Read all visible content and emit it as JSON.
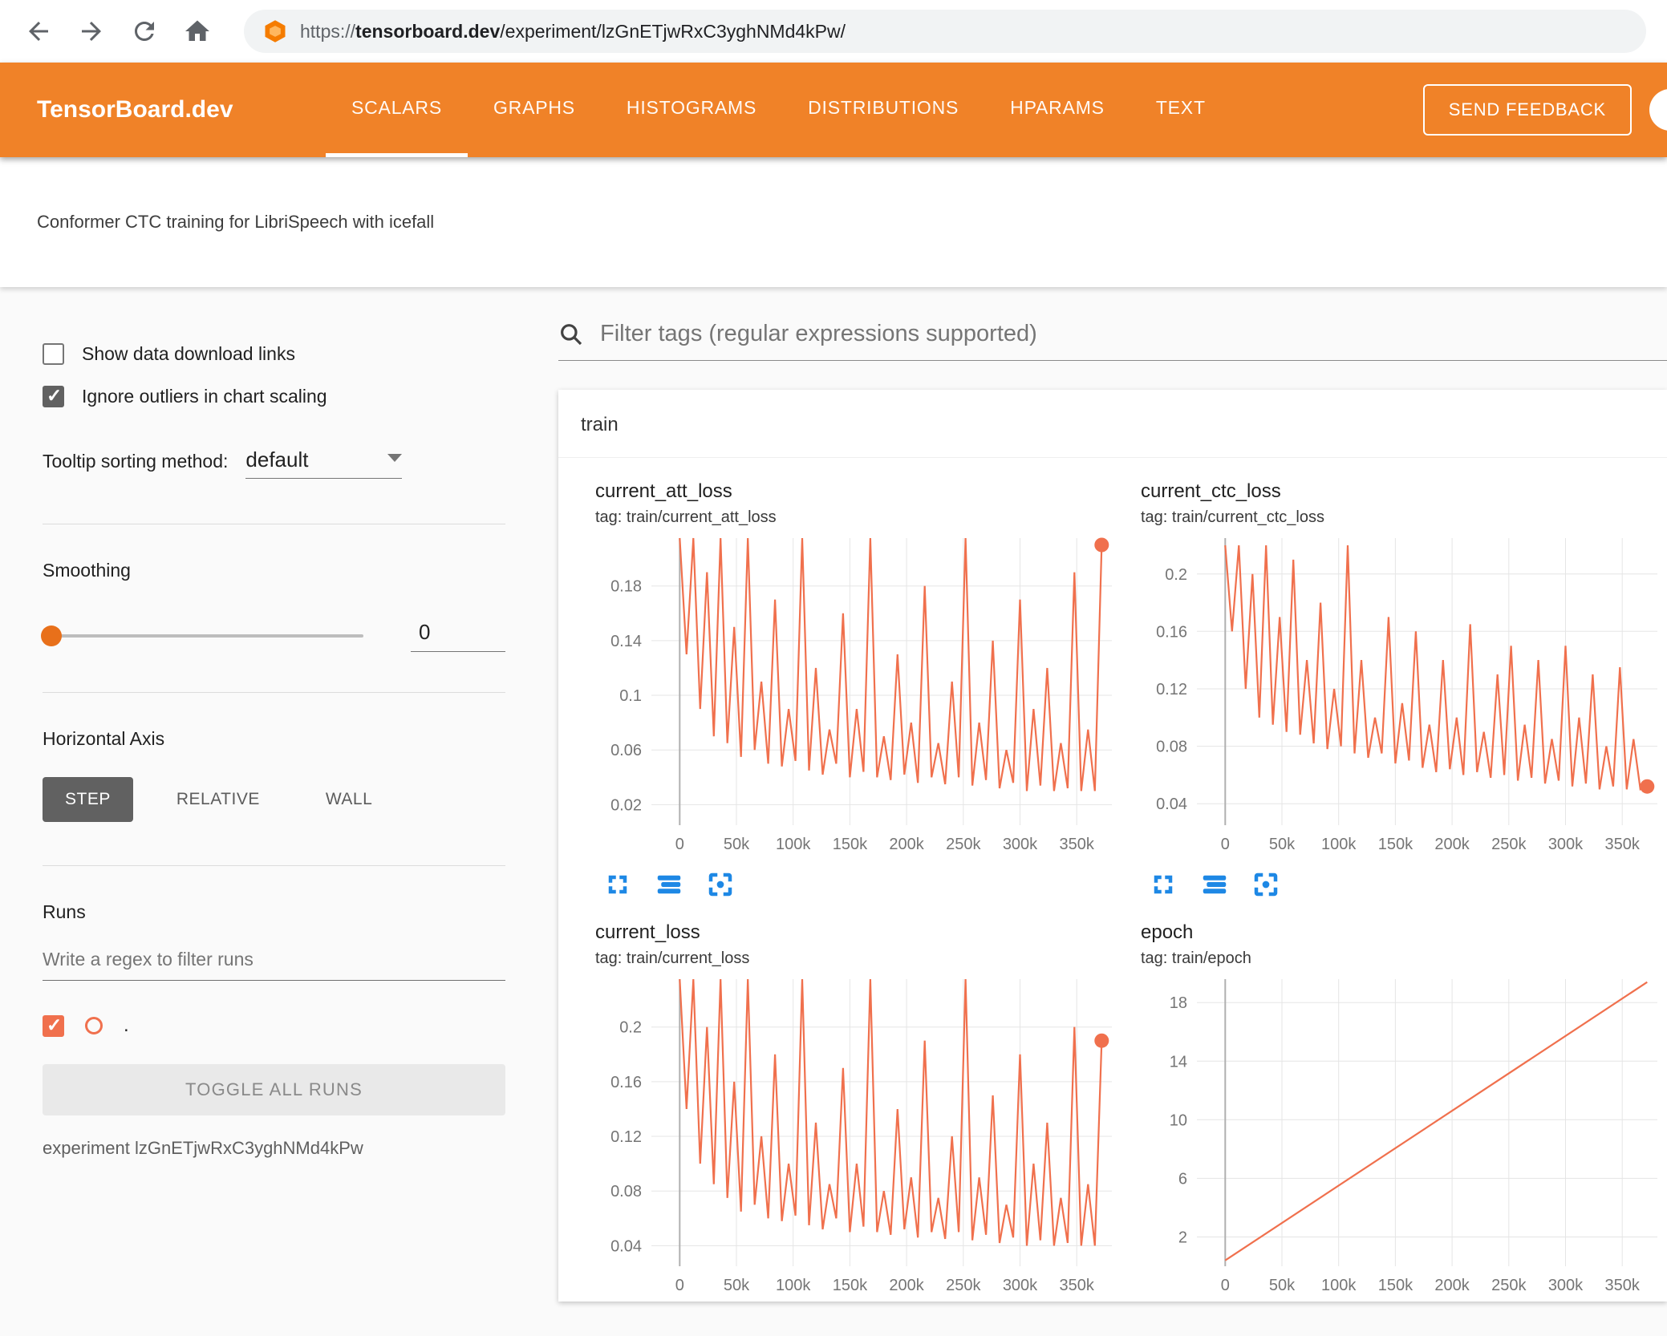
{
  "browser": {
    "url_scheme": "https://",
    "url_domain": "tensorboard.dev",
    "url_path": "/experiment/lzGnETjwRxC3yghNMd4kPw/"
  },
  "header": {
    "logo": "TensorBoard.dev",
    "tabs": [
      {
        "label": "SCALARS",
        "active": true
      },
      {
        "label": "GRAPHS",
        "active": false
      },
      {
        "label": "HISTOGRAMS",
        "active": false
      },
      {
        "label": "DISTRIBUTIONS",
        "active": false
      },
      {
        "label": "HPARAMS",
        "active": false
      },
      {
        "label": "TEXT",
        "active": false
      }
    ],
    "feedback_button": "SEND FEEDBACK"
  },
  "experiment_title": "Conformer CTC training for LibriSpeech with icefall",
  "sidebar": {
    "show_download": {
      "label": "Show data download links",
      "checked": false
    },
    "ignore_outliers": {
      "label": "Ignore outliers in chart scaling",
      "checked": true
    },
    "tooltip_sorting": {
      "label": "Tooltip sorting method:",
      "value": "default"
    },
    "smoothing": {
      "label": "Smoothing",
      "value": "0"
    },
    "horizontal_axis": {
      "label": "Horizontal Axis",
      "options": [
        "STEP",
        "RELATIVE",
        "WALL"
      ],
      "selected": "STEP"
    },
    "runs": {
      "label": "Runs",
      "filter_placeholder": "Write a regex to filter runs",
      "run_name": ".",
      "run_checked": true,
      "toggle_button": "TOGGLE ALL RUNS",
      "experiment_label": "experiment lzGnETjwRxC3yghNMd4kPw"
    }
  },
  "main": {
    "filter_placeholder": "Filter tags (regular expressions supported)",
    "section_title": "train"
  },
  "icons": {
    "back": "arrow-left",
    "forward": "arrow-right",
    "reload": "refresh",
    "home": "house",
    "search": "magnifier",
    "dropdown": "caret-down",
    "fullscreen": "expand-corners",
    "run-selector": "list-bars",
    "fit-data": "crop-frame"
  },
  "colors": {
    "header_orange": "#f08228",
    "accent_orange": "#e8701a",
    "run_color": "#f0704d",
    "icon_blue": "#1e88e5",
    "selected_button_bg": "#616161"
  },
  "chart_data": [
    {
      "type": "line",
      "title": "current_att_loss",
      "tag": "tag: train/current_att_loss",
      "color": "#f0704d",
      "end_dot": true,
      "xlim": [
        -25000,
        381000
      ],
      "ylim": [
        0.005,
        0.215
      ],
      "yticks": [
        {
          "v": 0.02,
          "l": "0.02"
        },
        {
          "v": 0.06,
          "l": "0.06"
        },
        {
          "v": 0.1,
          "l": "0.1"
        },
        {
          "v": 0.14,
          "l": "0.14"
        },
        {
          "v": 0.18,
          "l": "0.18"
        }
      ],
      "xticks": [
        {
          "v": 0,
          "l": "0"
        },
        {
          "v": 50000,
          "l": "50k"
        },
        {
          "v": 100000,
          "l": "100k"
        },
        {
          "v": 150000,
          "l": "150k"
        },
        {
          "v": 200000,
          "l": "200k"
        },
        {
          "v": 250000,
          "l": "250k"
        },
        {
          "v": 300000,
          "l": "300k"
        },
        {
          "v": 350000,
          "l": "350k"
        }
      ],
      "x": [
        0,
        6000,
        12000,
        18000,
        24000,
        30000,
        36000,
        42000,
        48000,
        54000,
        60000,
        66000,
        72000,
        78000,
        84000,
        90000,
        96000,
        102000,
        108000,
        114000,
        120000,
        126000,
        132000,
        138000,
        144000,
        150000,
        156000,
        162000,
        168000,
        174000,
        180000,
        186000,
        192000,
        198000,
        204000,
        210000,
        216000,
        222000,
        228000,
        234000,
        240000,
        246000,
        252000,
        258000,
        264000,
        270000,
        276000,
        282000,
        288000,
        294000,
        300000,
        306000,
        312000,
        318000,
        324000,
        330000,
        336000,
        342000,
        348000,
        354000,
        360000,
        366000,
        372000
      ],
      "y": [
        0.215,
        0.13,
        0.215,
        0.09,
        0.19,
        0.07,
        0.215,
        0.065,
        0.15,
        0.055,
        0.215,
        0.06,
        0.11,
        0.05,
        0.17,
        0.048,
        0.09,
        0.052,
        0.215,
        0.045,
        0.12,
        0.042,
        0.075,
        0.05,
        0.16,
        0.04,
        0.09,
        0.044,
        0.215,
        0.04,
        0.07,
        0.038,
        0.13,
        0.042,
        0.08,
        0.036,
        0.18,
        0.04,
        0.065,
        0.035,
        0.11,
        0.04,
        0.215,
        0.034,
        0.08,
        0.038,
        0.14,
        0.032,
        0.06,
        0.036,
        0.17,
        0.03,
        0.09,
        0.034,
        0.12,
        0.03,
        0.065,
        0.032,
        0.19,
        0.03,
        0.075,
        0.03,
        0.21
      ]
    },
    {
      "type": "line",
      "title": "current_ctc_loss",
      "tag": "tag: train/current_ctc_loss",
      "color": "#f0704d",
      "end_dot": true,
      "xlim": [
        -25000,
        381000
      ],
      "ylim": [
        0.025,
        0.225
      ],
      "yticks": [
        {
          "v": 0.04,
          "l": "0.04"
        },
        {
          "v": 0.08,
          "l": "0.08"
        },
        {
          "v": 0.12,
          "l": "0.12"
        },
        {
          "v": 0.16,
          "l": "0.16"
        },
        {
          "v": 0.2,
          "l": "0.2"
        }
      ],
      "xticks": [
        {
          "v": 0,
          "l": "0"
        },
        {
          "v": 50000,
          "l": "50k"
        },
        {
          "v": 100000,
          "l": "100k"
        },
        {
          "v": 150000,
          "l": "150k"
        },
        {
          "v": 200000,
          "l": "200k"
        },
        {
          "v": 250000,
          "l": "250k"
        },
        {
          "v": 300000,
          "l": "300k"
        },
        {
          "v": 350000,
          "l": "350k"
        }
      ],
      "x": [
        0,
        6000,
        12000,
        18000,
        24000,
        30000,
        36000,
        42000,
        48000,
        54000,
        60000,
        66000,
        72000,
        78000,
        84000,
        90000,
        96000,
        102000,
        108000,
        114000,
        120000,
        126000,
        132000,
        138000,
        144000,
        150000,
        156000,
        162000,
        168000,
        174000,
        180000,
        186000,
        192000,
        198000,
        204000,
        210000,
        216000,
        222000,
        228000,
        234000,
        240000,
        246000,
        252000,
        258000,
        264000,
        270000,
        276000,
        282000,
        288000,
        294000,
        300000,
        306000,
        312000,
        318000,
        324000,
        330000,
        336000,
        342000,
        348000,
        354000,
        360000,
        366000,
        372000
      ],
      "y": [
        0.22,
        0.16,
        0.22,
        0.12,
        0.2,
        0.1,
        0.22,
        0.095,
        0.17,
        0.09,
        0.21,
        0.088,
        0.14,
        0.082,
        0.18,
        0.078,
        0.12,
        0.08,
        0.22,
        0.075,
        0.14,
        0.072,
        0.1,
        0.075,
        0.17,
        0.068,
        0.11,
        0.07,
        0.16,
        0.065,
        0.095,
        0.062,
        0.14,
        0.064,
        0.1,
        0.06,
        0.165,
        0.062,
        0.09,
        0.058,
        0.13,
        0.06,
        0.15,
        0.056,
        0.095,
        0.058,
        0.14,
        0.054,
        0.085,
        0.056,
        0.15,
        0.052,
        0.1,
        0.054,
        0.13,
        0.05,
        0.08,
        0.052,
        0.135,
        0.05,
        0.085,
        0.05,
        0.052
      ]
    },
    {
      "type": "line",
      "title": "current_loss",
      "tag": "tag: train/current_loss",
      "color": "#f0704d",
      "end_dot": true,
      "xlim": [
        -25000,
        381000
      ],
      "ylim": [
        0.025,
        0.235
      ],
      "yticks": [
        {
          "v": 0.04,
          "l": "0.04"
        },
        {
          "v": 0.08,
          "l": "0.08"
        },
        {
          "v": 0.12,
          "l": "0.12"
        },
        {
          "v": 0.16,
          "l": "0.16"
        },
        {
          "v": 0.2,
          "l": "0.2"
        }
      ],
      "xticks": [
        {
          "v": 0,
          "l": "0"
        },
        {
          "v": 50000,
          "l": "50k"
        },
        {
          "v": 100000,
          "l": "100k"
        },
        {
          "v": 150000,
          "l": "150k"
        },
        {
          "v": 200000,
          "l": "200k"
        },
        {
          "v": 250000,
          "l": "250k"
        },
        {
          "v": 300000,
          "l": "300k"
        },
        {
          "v": 350000,
          "l": "350k"
        }
      ],
      "x": [
        0,
        6000,
        12000,
        18000,
        24000,
        30000,
        36000,
        42000,
        48000,
        54000,
        60000,
        66000,
        72000,
        78000,
        84000,
        90000,
        96000,
        102000,
        108000,
        114000,
        120000,
        126000,
        132000,
        138000,
        144000,
        150000,
        156000,
        162000,
        168000,
        174000,
        180000,
        186000,
        192000,
        198000,
        204000,
        210000,
        216000,
        222000,
        228000,
        234000,
        240000,
        246000,
        252000,
        258000,
        264000,
        270000,
        276000,
        282000,
        288000,
        294000,
        300000,
        306000,
        312000,
        318000,
        324000,
        330000,
        336000,
        342000,
        348000,
        354000,
        360000,
        366000,
        372000
      ],
      "y": [
        0.235,
        0.14,
        0.235,
        0.1,
        0.2,
        0.085,
        0.235,
        0.075,
        0.16,
        0.065,
        0.235,
        0.07,
        0.12,
        0.06,
        0.18,
        0.058,
        0.1,
        0.062,
        0.235,
        0.055,
        0.13,
        0.052,
        0.085,
        0.06,
        0.17,
        0.05,
        0.1,
        0.054,
        0.235,
        0.05,
        0.08,
        0.048,
        0.14,
        0.052,
        0.09,
        0.046,
        0.19,
        0.05,
        0.075,
        0.045,
        0.12,
        0.05,
        0.235,
        0.044,
        0.09,
        0.048,
        0.15,
        0.042,
        0.07,
        0.046,
        0.18,
        0.04,
        0.1,
        0.044,
        0.13,
        0.04,
        0.075,
        0.042,
        0.2,
        0.04,
        0.085,
        0.04,
        0.19
      ]
    },
    {
      "type": "line",
      "title": "epoch",
      "tag": "tag: train/epoch",
      "color": "#f0704d",
      "end_dot": false,
      "xlim": [
        -25000,
        381000
      ],
      "ylim": [
        0,
        19.6
      ],
      "yticks": [
        {
          "v": 2,
          "l": "2"
        },
        {
          "v": 6,
          "l": "6"
        },
        {
          "v": 10,
          "l": "10"
        },
        {
          "v": 14,
          "l": "14"
        },
        {
          "v": 18,
          "l": "18"
        }
      ],
      "xticks": [
        {
          "v": 0,
          "l": "0"
        },
        {
          "v": 50000,
          "l": "50k"
        },
        {
          "v": 100000,
          "l": "100k"
        },
        {
          "v": 150000,
          "l": "150k"
        },
        {
          "v": 200000,
          "l": "200k"
        },
        {
          "v": 250000,
          "l": "250k"
        },
        {
          "v": 300000,
          "l": "300k"
        },
        {
          "v": 350000,
          "l": "350k"
        }
      ],
      "x": [
        0,
        372000
      ],
      "y": [
        0.4,
        19.4
      ]
    }
  ]
}
